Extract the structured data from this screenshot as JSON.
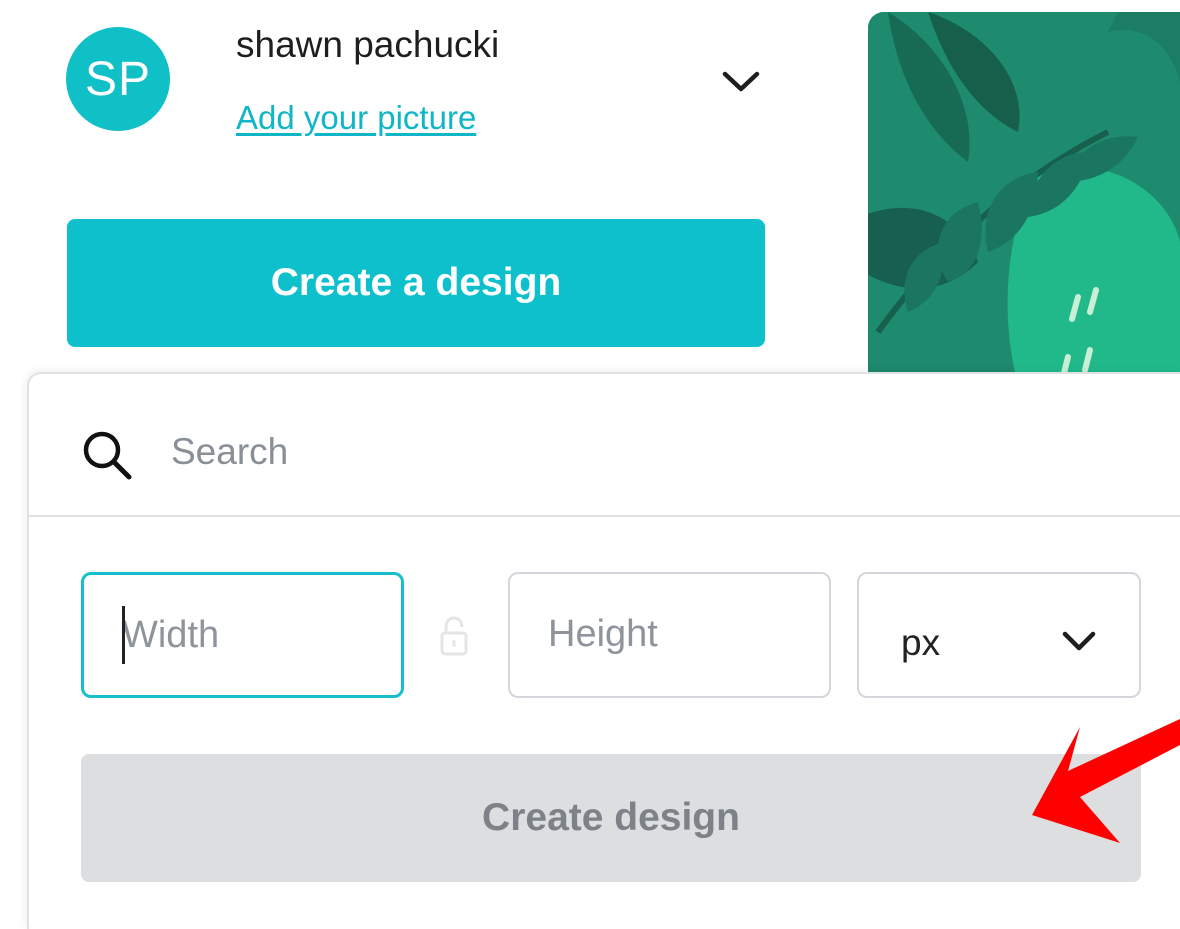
{
  "account": {
    "initials": "SP",
    "user_name": "shawn pachucki",
    "add_picture_link": "Add your picture",
    "menu_icon": "chevron-down-icon"
  },
  "primary_action": {
    "label": "Create a design"
  },
  "custom_size_panel": {
    "search": {
      "icon": "search-icon",
      "placeholder": "Search",
      "value": ""
    },
    "width": {
      "placeholder": "Width",
      "value": ""
    },
    "lock_icon": "lock-icon",
    "height": {
      "placeholder": "Height",
      "value": ""
    },
    "unit": {
      "selected": "px",
      "icon": "chevron-down-icon"
    },
    "submit": {
      "label": "Create design",
      "disabled": true
    }
  },
  "colors": {
    "brand": "#0dc0cc",
    "avatar": "#0fc0c7",
    "link": "#10b6c8",
    "disabled_button_bg": "#dcdee0",
    "disabled_button_text": "#7c8287",
    "focus_border": "#17bfcc",
    "annotation_arrow": "#ff0000",
    "artwork_background": "#1e8a6e"
  }
}
